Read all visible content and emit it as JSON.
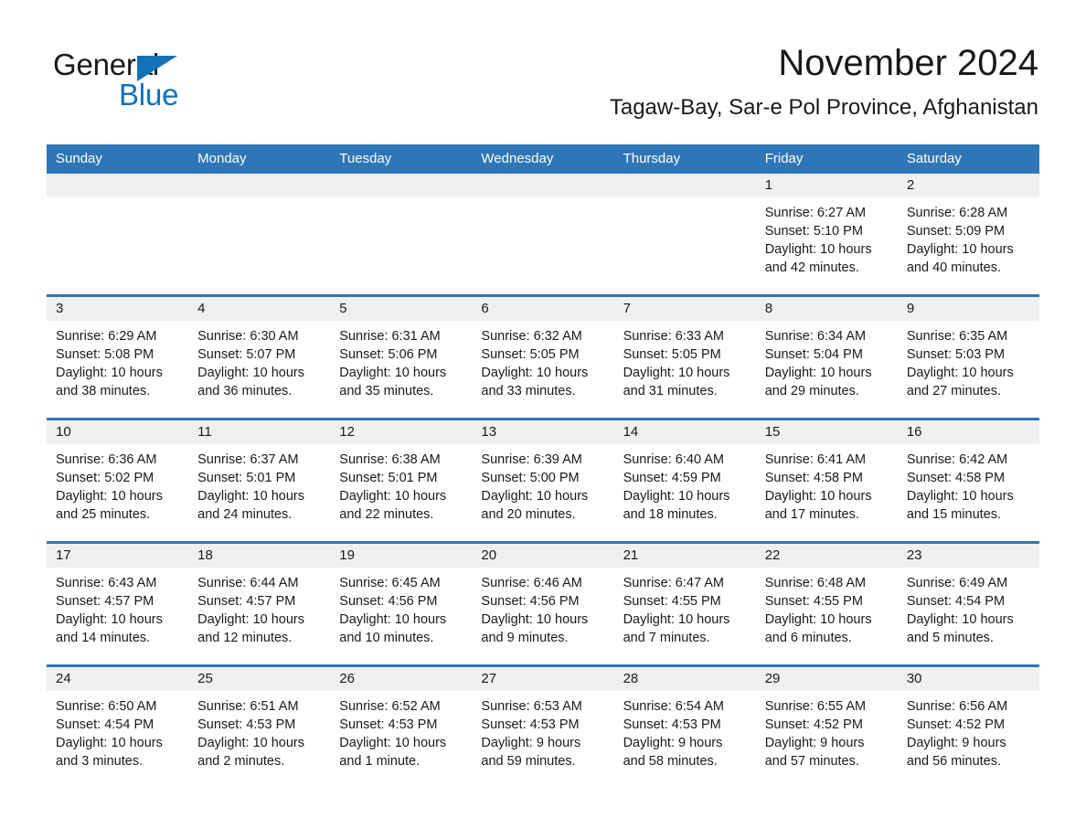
{
  "brand": {
    "name_part1": "General",
    "name_part2": "Blue",
    "accent_color": "#1272b8"
  },
  "header": {
    "month_title": "November 2024",
    "location": "Tagaw-Bay, Sar-e Pol Province, Afghanistan"
  },
  "theme": {
    "header_blue": "#2f76b6",
    "row_divider_blue": "#2f76b6",
    "daynum_band": "#f0f0f0",
    "text": "#1a1a1a"
  },
  "calendar": {
    "weekdays": [
      "Sunday",
      "Monday",
      "Tuesday",
      "Wednesday",
      "Thursday",
      "Friday",
      "Saturday"
    ],
    "labels": {
      "sunrise_prefix": "Sunrise: ",
      "sunset_prefix": "Sunset: ",
      "daylight_prefix": "Daylight: "
    },
    "weeks": [
      [
        {
          "day": "",
          "sunrise": "",
          "sunset": "",
          "daylight": "",
          "empty": true
        },
        {
          "day": "",
          "sunrise": "",
          "sunset": "",
          "daylight": "",
          "empty": true
        },
        {
          "day": "",
          "sunrise": "",
          "sunset": "",
          "daylight": "",
          "empty": true
        },
        {
          "day": "",
          "sunrise": "",
          "sunset": "",
          "daylight": "",
          "empty": true
        },
        {
          "day": "",
          "sunrise": "",
          "sunset": "",
          "daylight": "",
          "empty": true
        },
        {
          "day": "1",
          "sunrise": "Sunrise: 6:27 AM",
          "sunset": "Sunset: 5:10 PM",
          "daylight": "Daylight: 10 hours and 42 minutes.",
          "empty": false
        },
        {
          "day": "2",
          "sunrise": "Sunrise: 6:28 AM",
          "sunset": "Sunset: 5:09 PM",
          "daylight": "Daylight: 10 hours and 40 minutes.",
          "empty": false
        }
      ],
      [
        {
          "day": "3",
          "sunrise": "Sunrise: 6:29 AM",
          "sunset": "Sunset: 5:08 PM",
          "daylight": "Daylight: 10 hours and 38 minutes.",
          "empty": false
        },
        {
          "day": "4",
          "sunrise": "Sunrise: 6:30 AM",
          "sunset": "Sunset: 5:07 PM",
          "daylight": "Daylight: 10 hours and 36 minutes.",
          "empty": false
        },
        {
          "day": "5",
          "sunrise": "Sunrise: 6:31 AM",
          "sunset": "Sunset: 5:06 PM",
          "daylight": "Daylight: 10 hours and 35 minutes.",
          "empty": false
        },
        {
          "day": "6",
          "sunrise": "Sunrise: 6:32 AM",
          "sunset": "Sunset: 5:05 PM",
          "daylight": "Daylight: 10 hours and 33 minutes.",
          "empty": false
        },
        {
          "day": "7",
          "sunrise": "Sunrise: 6:33 AM",
          "sunset": "Sunset: 5:05 PM",
          "daylight": "Daylight: 10 hours and 31 minutes.",
          "empty": false
        },
        {
          "day": "8",
          "sunrise": "Sunrise: 6:34 AM",
          "sunset": "Sunset: 5:04 PM",
          "daylight": "Daylight: 10 hours and 29 minutes.",
          "empty": false
        },
        {
          "day": "9",
          "sunrise": "Sunrise: 6:35 AM",
          "sunset": "Sunset: 5:03 PM",
          "daylight": "Daylight: 10 hours and 27 minutes.",
          "empty": false
        }
      ],
      [
        {
          "day": "10",
          "sunrise": "Sunrise: 6:36 AM",
          "sunset": "Sunset: 5:02 PM",
          "daylight": "Daylight: 10 hours and 25 minutes.",
          "empty": false
        },
        {
          "day": "11",
          "sunrise": "Sunrise: 6:37 AM",
          "sunset": "Sunset: 5:01 PM",
          "daylight": "Daylight: 10 hours and 24 minutes.",
          "empty": false
        },
        {
          "day": "12",
          "sunrise": "Sunrise: 6:38 AM",
          "sunset": "Sunset: 5:01 PM",
          "daylight": "Daylight: 10 hours and 22 minutes.",
          "empty": false
        },
        {
          "day": "13",
          "sunrise": "Sunrise: 6:39 AM",
          "sunset": "Sunset: 5:00 PM",
          "daylight": "Daylight: 10 hours and 20 minutes.",
          "empty": false
        },
        {
          "day": "14",
          "sunrise": "Sunrise: 6:40 AM",
          "sunset": "Sunset: 4:59 PM",
          "daylight": "Daylight: 10 hours and 18 minutes.",
          "empty": false
        },
        {
          "day": "15",
          "sunrise": "Sunrise: 6:41 AM",
          "sunset": "Sunset: 4:58 PM",
          "daylight": "Daylight: 10 hours and 17 minutes.",
          "empty": false
        },
        {
          "day": "16",
          "sunrise": "Sunrise: 6:42 AM",
          "sunset": "Sunset: 4:58 PM",
          "daylight": "Daylight: 10 hours and 15 minutes.",
          "empty": false
        }
      ],
      [
        {
          "day": "17",
          "sunrise": "Sunrise: 6:43 AM",
          "sunset": "Sunset: 4:57 PM",
          "daylight": "Daylight: 10 hours and 14 minutes.",
          "empty": false
        },
        {
          "day": "18",
          "sunrise": "Sunrise: 6:44 AM",
          "sunset": "Sunset: 4:57 PM",
          "daylight": "Daylight: 10 hours and 12 minutes.",
          "empty": false
        },
        {
          "day": "19",
          "sunrise": "Sunrise: 6:45 AM",
          "sunset": "Sunset: 4:56 PM",
          "daylight": "Daylight: 10 hours and 10 minutes.",
          "empty": false
        },
        {
          "day": "20",
          "sunrise": "Sunrise: 6:46 AM",
          "sunset": "Sunset: 4:56 PM",
          "daylight": "Daylight: 10 hours and 9 minutes.",
          "empty": false
        },
        {
          "day": "21",
          "sunrise": "Sunrise: 6:47 AM",
          "sunset": "Sunset: 4:55 PM",
          "daylight": "Daylight: 10 hours and 7 minutes.",
          "empty": false
        },
        {
          "day": "22",
          "sunrise": "Sunrise: 6:48 AM",
          "sunset": "Sunset: 4:55 PM",
          "daylight": "Daylight: 10 hours and 6 minutes.",
          "empty": false
        },
        {
          "day": "23",
          "sunrise": "Sunrise: 6:49 AM",
          "sunset": "Sunset: 4:54 PM",
          "daylight": "Daylight: 10 hours and 5 minutes.",
          "empty": false
        }
      ],
      [
        {
          "day": "24",
          "sunrise": "Sunrise: 6:50 AM",
          "sunset": "Sunset: 4:54 PM",
          "daylight": "Daylight: 10 hours and 3 minutes.",
          "empty": false
        },
        {
          "day": "25",
          "sunrise": "Sunrise: 6:51 AM",
          "sunset": "Sunset: 4:53 PM",
          "daylight": "Daylight: 10 hours and 2 minutes.",
          "empty": false
        },
        {
          "day": "26",
          "sunrise": "Sunrise: 6:52 AM",
          "sunset": "Sunset: 4:53 PM",
          "daylight": "Daylight: 10 hours and 1 minute.",
          "empty": false
        },
        {
          "day": "27",
          "sunrise": "Sunrise: 6:53 AM",
          "sunset": "Sunset: 4:53 PM",
          "daylight": "Daylight: 9 hours and 59 minutes.",
          "empty": false
        },
        {
          "day": "28",
          "sunrise": "Sunrise: 6:54 AM",
          "sunset": "Sunset: 4:53 PM",
          "daylight": "Daylight: 9 hours and 58 minutes.",
          "empty": false
        },
        {
          "day": "29",
          "sunrise": "Sunrise: 6:55 AM",
          "sunset": "Sunset: 4:52 PM",
          "daylight": "Daylight: 9 hours and 57 minutes.",
          "empty": false
        },
        {
          "day": "30",
          "sunrise": "Sunrise: 6:56 AM",
          "sunset": "Sunset: 4:52 PM",
          "daylight": "Daylight: 9 hours and 56 minutes.",
          "empty": false
        }
      ]
    ]
  }
}
